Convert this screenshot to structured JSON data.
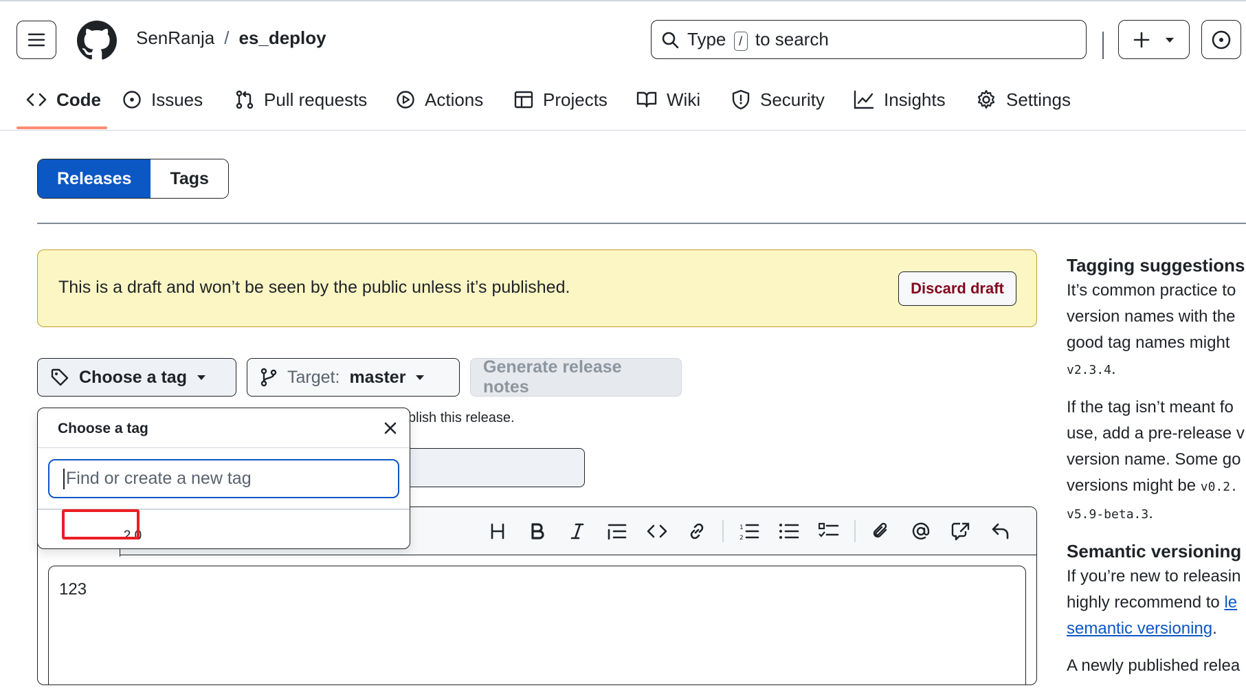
{
  "header": {
    "owner": "SenRanja",
    "separator": "/",
    "repo": "es_deploy",
    "search": {
      "prefix": "Type",
      "key": "/",
      "suffix": "to search"
    }
  },
  "nav": {
    "tabs": [
      {
        "label": "Code",
        "icon": "code-icon",
        "active": true
      },
      {
        "label": "Issues",
        "icon": "issue-icon"
      },
      {
        "label": "Pull requests",
        "icon": "pull-request-icon"
      },
      {
        "label": "Actions",
        "icon": "play-icon"
      },
      {
        "label": "Projects",
        "icon": "table-icon"
      },
      {
        "label": "Wiki",
        "icon": "book-icon"
      },
      {
        "label": "Security",
        "icon": "shield-icon"
      },
      {
        "label": "Insights",
        "icon": "graph-icon"
      },
      {
        "label": "Settings",
        "icon": "gear-icon"
      }
    ]
  },
  "subnav": {
    "releases": "Releases",
    "tags": "Tags"
  },
  "banner": {
    "text": "This is a draft and won’t be seen by the public unless it’s published.",
    "discard": "Discard draft"
  },
  "form": {
    "choose_tag": "Choose a tag",
    "target_label": "Target:",
    "target_value": "master",
    "generate_notes": "Generate release notes",
    "hint": "blish this release.",
    "body_text": "123"
  },
  "popover": {
    "title": "Choose a tag",
    "placeholder": "Find or create a new tag",
    "items": [
      "2.0"
    ]
  },
  "sidebar": {
    "heading1": "Tagging suggestions",
    "p1_lines": [
      "It’s common practice to",
      "version names with the",
      "good tag names might"
    ],
    "p1_code": "v2.3.4",
    "p2_lines": [
      "If the tag isn’t meant fo",
      "use, add a pre-release v",
      "version name. Some go"
    ],
    "p2_line4": "versions might be",
    "p2_code1": "v0.2.",
    "p2_code2": "v5.9-beta.3",
    "heading2": "Semantic versioning",
    "p3_lines": [
      "If you’re new to releasin",
      "highly recommend to"
    ],
    "p3_link1": "le",
    "p3_link2": "semantic versioning",
    "p4_line": "A newly published relea"
  },
  "colors": {
    "accent": "#0b57c4",
    "banner_bg": "#fbf6c4",
    "danger": "#82071e",
    "highlight": "#ec1c24",
    "tab_underline": "#fd8c73"
  }
}
